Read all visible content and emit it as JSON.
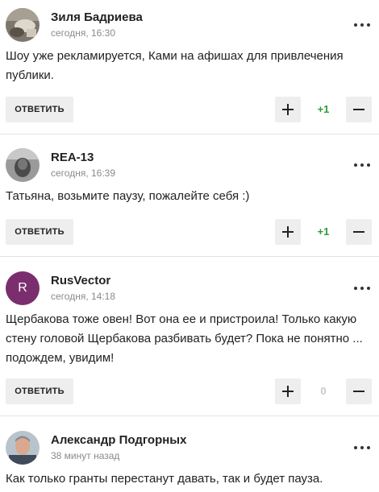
{
  "comments": [
    {
      "author": "Зиля Бадриева",
      "time": "сегодня, 16:30",
      "avatar": "photo-avatar-icon",
      "text": "Шоу уже рекламируется, Ками на афишах для привлечения публики.",
      "reply_label": "ОТВЕТИТЬ",
      "score": "+1"
    },
    {
      "author": "REA-13",
      "time": "сегодня, 16:39",
      "avatar": "photo-avatar-icon",
      "text": "Татьяна, возьмите паузу, пожалейте себя :)",
      "reply_label": "ОТВЕТИТЬ",
      "score": "+1"
    },
    {
      "author": "RusVector",
      "time": "сегодня, 14:18",
      "avatar_letter": "R",
      "avatar_color": "#7a2e6e",
      "text": "Щербакова тоже овен! Вот она ее и пристроила! Только какую стену головой Щербакова разбивать будет? Пока не понятно ... подождем, увидим!",
      "reply_label": "ОТВЕТИТЬ",
      "score": "0"
    },
    {
      "author": "Александр Подгорных",
      "time": "38 минут назад",
      "avatar": "photo-avatar-icon",
      "text": "Как только гранты перестанут давать, так и будет пауза."
    }
  ],
  "colors": {
    "positive_score": "#2e9b3a",
    "zero_score": "#c9c9c9",
    "button_bg": "#eeeeee",
    "muted_text": "#8a8a8a"
  }
}
